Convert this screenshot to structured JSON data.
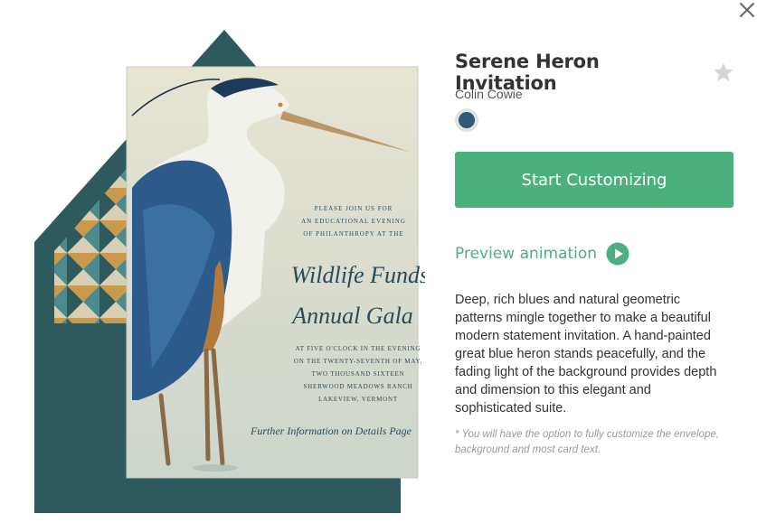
{
  "close": {
    "icon": "close-icon"
  },
  "product": {
    "title": "Serene Heron Invitation",
    "designer": "Colin Cowie",
    "swatch_color": "#2d5b79",
    "cta_label": "Start Customizing",
    "preview_label": "Preview animation",
    "description": "Deep, rich blues and natural geometric patterns mingle together to make a beautiful modern statement invitation. A hand-painted great blue heron stands peacefully, and the fading light of the background provides depth and dimension to this elegant and sophisticated suite.",
    "note": "* You will have the option to fully customize the envelope, background and most card text."
  },
  "card": {
    "intro_lines": [
      "PLEASE JOIN US FOR",
      "AN EDUCATIONAL EVENING",
      "OF PHILANTHROPY AT THE"
    ],
    "event_title_1": "Wildlife Funds",
    "event_title_2": "Annual Gala",
    "detail_lines": [
      "AT FIVE O'CLOCK IN THE EVENING",
      "ON THE TWENTY-SEVENTH OF MAY,",
      "TWO THOUSAND SIXTEEN",
      "SHERWOOD MEADOWS RANCH",
      "LAKEVIEW, VERMONT"
    ],
    "footer": "Further Information on Details Page"
  },
  "colors": {
    "accent_green": "#4cb07c",
    "envelope": "#2e5a5e",
    "card_bg": "#e9e6d6",
    "heron_blue": "#2c5a8a"
  }
}
